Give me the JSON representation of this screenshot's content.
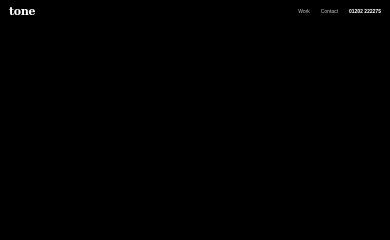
{
  "header": {
    "logo": "tone",
    "nav": {
      "work": "Work",
      "contact": "Contact",
      "phone": "01202 222275"
    }
  },
  "colors": {
    "background": "#000000",
    "logo": "#ffffff",
    "nav_text": "#bfbfbf",
    "phone_text": "#ffffff"
  }
}
